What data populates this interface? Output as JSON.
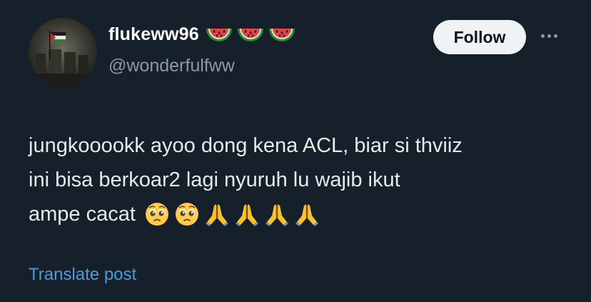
{
  "user": {
    "display_name": "flukeww96",
    "handle": "@wonderfulfww",
    "badge_icons": [
      "watermelon-icon",
      "watermelon-icon",
      "watermelon-icon"
    ]
  },
  "actions": {
    "follow_label": "Follow",
    "more_icon": "more-horizontal-icon"
  },
  "tweet": {
    "lines": [
      "jungkooookk ayoo dong kena ACL, biar si thviiz",
      "ini bisa berkoar2 lagi nyuruh lu wajib ikut",
      "ampe cacat"
    ],
    "emoji_icons": [
      "pleading-face-icon",
      "pleading-face-icon",
      "folded-hands-icon",
      "folded-hands-icon",
      "folded-hands-icon",
      "folded-hands-icon"
    ]
  },
  "footer": {
    "translate_label": "Translate post"
  },
  "colors": {
    "background": "#15202b",
    "text": "#e7e9ea",
    "muted": "#8b98a5",
    "link": "#4e9bd7",
    "button_bg": "#eff3f4"
  }
}
